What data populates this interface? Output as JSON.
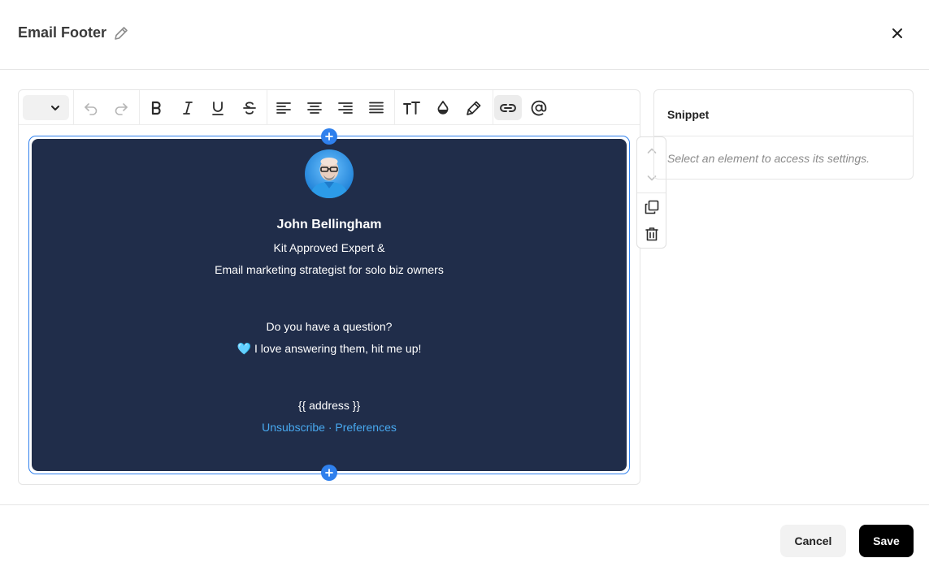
{
  "header": {
    "title": "Email Footer",
    "edit_icon": "pencil-icon",
    "close_icon": "close-icon"
  },
  "toolbar": {
    "items": [
      "style-select",
      "undo-icon",
      "redo-icon",
      "bold-icon",
      "italic-icon",
      "underline-icon",
      "strikethrough-icon",
      "align-left-icon",
      "align-center-icon",
      "align-right-icon",
      "align-justify-icon",
      "text-size-icon",
      "text-color-icon",
      "highlight-icon",
      "link-icon",
      "mention-icon"
    ],
    "active_item": "link-icon"
  },
  "footer_block": {
    "background": "#202d4a",
    "name": "John Bellingham",
    "tagline_1": "Kit Approved Expert &",
    "tagline_2": "Email marketing strategist for solo biz owners",
    "question": "Do you have a question?",
    "heart": "🩵",
    "answer": "I love answering them, hit me up!",
    "address": "{{ address }}",
    "unsubscribe": "Unsubscribe",
    "separator": "·",
    "preferences": "Preferences",
    "link_color": "#48a9f0"
  },
  "side_tools": [
    "move-up-icon",
    "move-down-icon",
    "duplicate-icon",
    "delete-icon"
  ],
  "panel": {
    "title": "Snippet",
    "hint": "Select an element to access its settings."
  },
  "actions": {
    "cancel_label": "Cancel",
    "save_label": "Save"
  },
  "colors": {
    "accent": "#2f80ed",
    "primary_button": "#000000"
  }
}
